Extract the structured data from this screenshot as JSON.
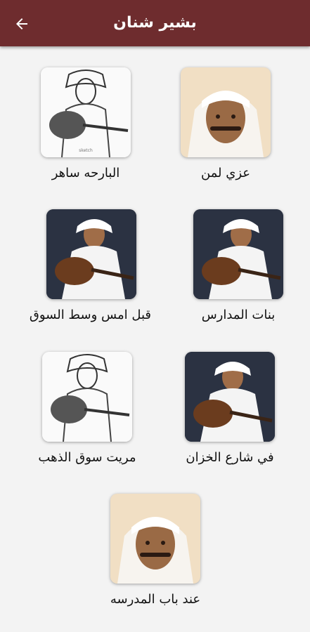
{
  "header": {
    "title": "بشير شنان",
    "back_icon": "arrow-left-icon",
    "background": "#6e2c2e"
  },
  "songs": [
    {
      "title": "عزي لمن",
      "art": "portrait"
    },
    {
      "title": "البارحه ساهر",
      "art": "sketch"
    },
    {
      "title": "بنات المدارس",
      "art": "oud-dark"
    },
    {
      "title": "قبل امس وسط السوق",
      "art": "oud-dark"
    },
    {
      "title": "في شارع الخزان",
      "art": "oud-dark"
    },
    {
      "title": "مريت سوق الذهب",
      "art": "sketch"
    },
    {
      "title": "عند باب المدرسه",
      "art": "portrait"
    }
  ]
}
